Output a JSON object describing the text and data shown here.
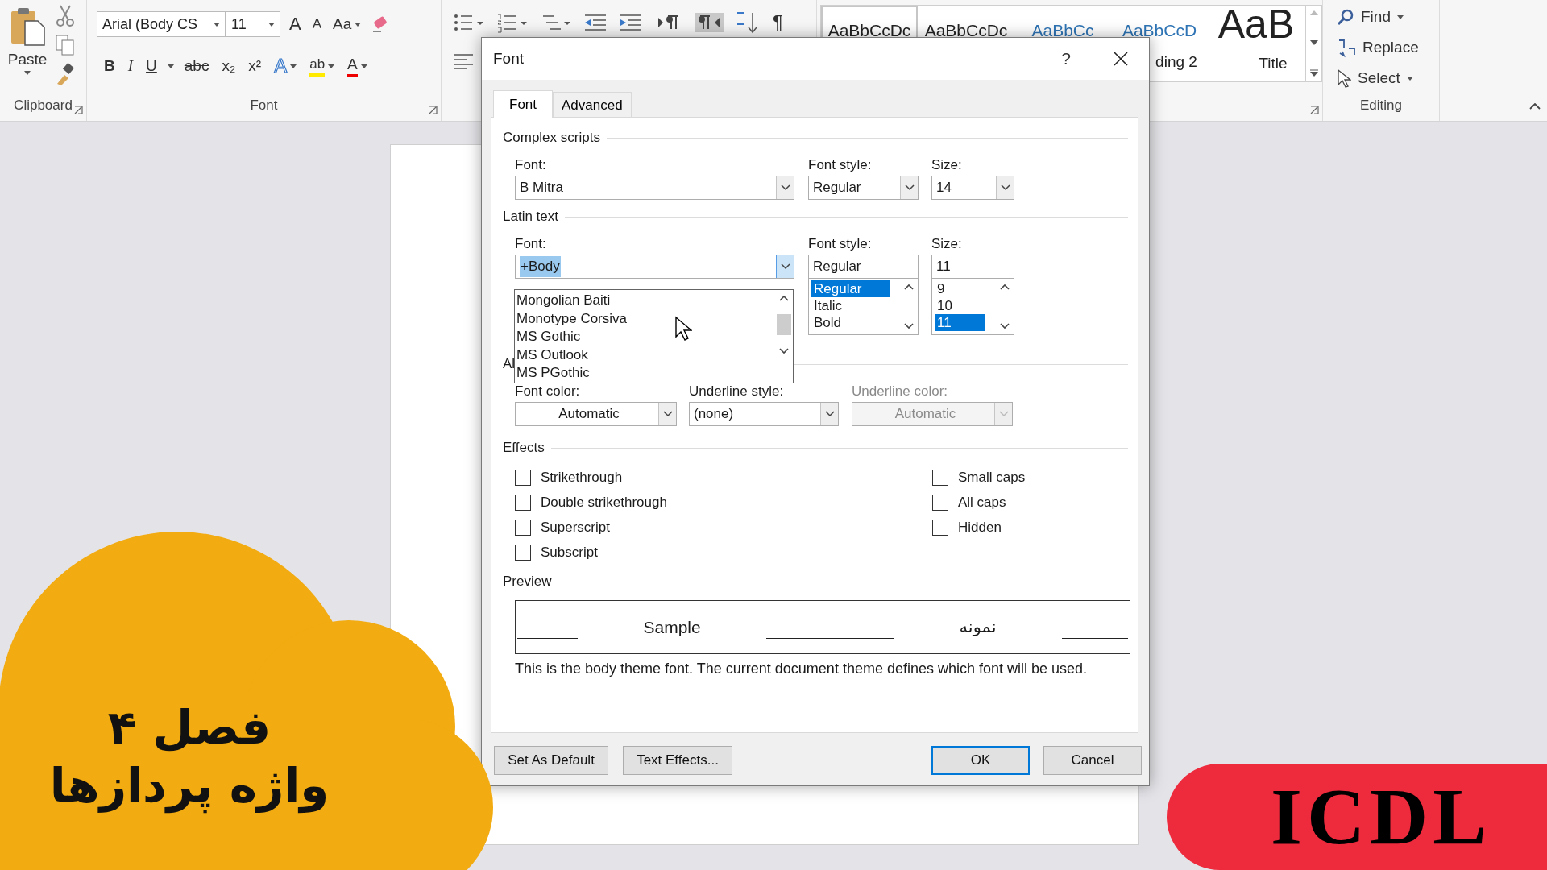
{
  "ribbon": {
    "clipboard": {
      "paste": "Paste",
      "label": "Clipboard"
    },
    "font": {
      "name": "Arial (Body CS",
      "size": "11",
      "grow": "A",
      "shrink": "A",
      "change_case": "Aa",
      "marks": [
        "B",
        "I",
        "U",
        "abc",
        "x₂",
        "x²"
      ],
      "effects": "A",
      "highlight": "ab",
      "color_glyph": "A",
      "label": "Font"
    },
    "paragraph": {
      "rtl_pressed": true,
      "pilcrow": "¶"
    },
    "styles": {
      "items": [
        {
          "sample": "AaBbCcDc",
          "selected": true
        },
        {
          "sample": "AaBbCcDc",
          "selected": false
        },
        {
          "sample": "AaBbCc",
          "selected": false
        },
        {
          "sample": "AaBbCcD",
          "label": "ding 2",
          "selected": false
        },
        {
          "sample": "AaB",
          "label": "Title",
          "selected": false
        }
      ]
    },
    "editing": {
      "find": "Find",
      "replace": "Replace",
      "select": "Select",
      "label": "Editing"
    }
  },
  "dialog": {
    "title": "Font",
    "help": "?",
    "tabs": [
      {
        "label": "Font",
        "selected": true
      },
      {
        "label": "Advanced",
        "selected": false
      }
    ],
    "complex": {
      "heading": "Complex scripts",
      "font": {
        "label": "Font:",
        "value": "B Mitra"
      },
      "style": {
        "label": "Font style:",
        "value": "Regular"
      },
      "size": {
        "label": "Size:",
        "value": "14"
      }
    },
    "latin": {
      "heading": "Latin text",
      "font": {
        "label": "Font:",
        "value": "+Body",
        "text_selected": true,
        "options": [
          "Mongolian Baiti",
          "Monotype Corsiva",
          "MS Gothic",
          "MS Outlook",
          "MS PGothic"
        ]
      },
      "style": {
        "label": "Font style:",
        "value": "Regular",
        "options": [
          {
            "text": "Regular",
            "selected": true
          },
          {
            "text": "Italic",
            "selected": false
          },
          {
            "text": "Bold",
            "selected": false
          }
        ]
      },
      "size": {
        "label": "Size:",
        "value": "11",
        "options": [
          {
            "text": "9",
            "selected": false
          },
          {
            "text": "10",
            "selected": false
          },
          {
            "text": "11",
            "selected": true
          }
        ]
      }
    },
    "all_text": {
      "heading": "Al",
      "fields": [
        {
          "label": "Font color:",
          "value": "Automatic",
          "disabled": false
        },
        {
          "label": "Underline style:",
          "value": "(none)",
          "disabled": false
        },
        {
          "label": "Underline color:",
          "value": "Automatic",
          "disabled": true
        }
      ]
    },
    "effects": {
      "heading": "Effects",
      "left": [
        {
          "label": "Strikethrough",
          "checked": false
        },
        {
          "label": "Double strikethrough",
          "checked": false
        },
        {
          "label": "Superscript",
          "checked": false
        },
        {
          "label": "Subscript",
          "checked": false
        }
      ],
      "right": [
        {
          "label": "Small caps",
          "checked": false
        },
        {
          "label": "All caps",
          "checked": false
        },
        {
          "label": "Hidden",
          "checked": false
        }
      ]
    },
    "preview": {
      "heading": "Preview",
      "latin_sample": "Sample",
      "complex_sample": "نمونه",
      "note": "This is the body theme font. The current document theme defines which font will be used."
    },
    "buttons": [
      {
        "label": "Set As Default",
        "default": false
      },
      {
        "label": "Text Effects...",
        "default": false
      },
      {
        "label": "OK",
        "default": true
      },
      {
        "label": "Cancel",
        "default": false
      }
    ]
  },
  "overlay": {
    "chapter": "فصل ۴",
    "subject": "واژه پردازها",
    "brand": "ICDL"
  }
}
